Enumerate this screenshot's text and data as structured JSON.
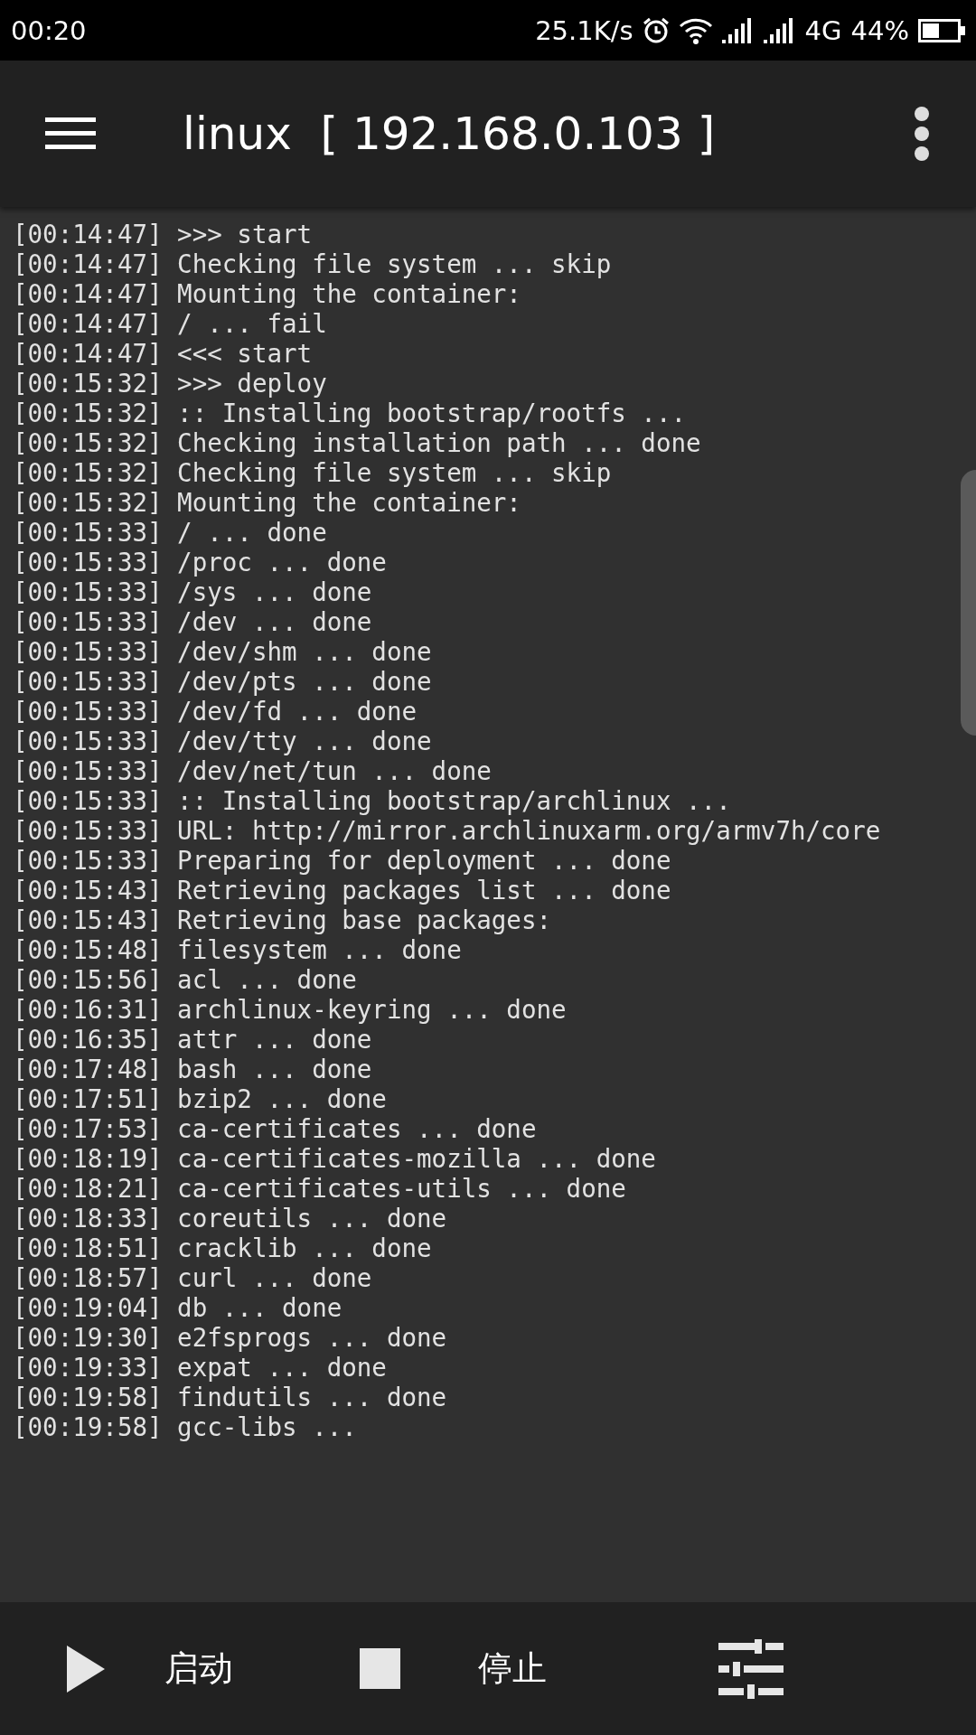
{
  "status_bar": {
    "time": "00:20",
    "speed": "25.1K/s",
    "network": "4G",
    "battery": "44%"
  },
  "toolbar": {
    "title": "linux  [ 192.168.0.103 ]"
  },
  "log": [
    "[00:14:47] >>> start",
    "[00:14:47] Checking file system ... skip",
    "[00:14:47] Mounting the container:",
    "[00:14:47] / ... fail",
    "[00:14:47] <<< start",
    "[00:15:32] >>> deploy",
    "[00:15:32] :: Installing bootstrap/rootfs ...",
    "[00:15:32] Checking installation path ... done",
    "[00:15:32] Checking file system ... skip",
    "[00:15:32] Mounting the container:",
    "[00:15:33] / ... done",
    "[00:15:33] /proc ... done",
    "[00:15:33] /sys ... done",
    "[00:15:33] /dev ... done",
    "[00:15:33] /dev/shm ... done",
    "[00:15:33] /dev/pts ... done",
    "[00:15:33] /dev/fd ... done",
    "[00:15:33] /dev/tty ... done",
    "[00:15:33] /dev/net/tun ... done",
    "[00:15:33] :: Installing bootstrap/archlinux ...",
    "[00:15:33] URL: http://mirror.archlinuxarm.org/armv7h/core",
    "[00:15:33] Preparing for deployment ... done",
    "[00:15:43] Retrieving packages list ... done",
    "[00:15:43] Retrieving base packages:",
    "[00:15:48] filesystem ... done",
    "[00:15:56] acl ... done",
    "[00:16:31] archlinux-keyring ... done",
    "[00:16:35] attr ... done",
    "[00:17:48] bash ... done",
    "[00:17:51] bzip2 ... done",
    "[00:17:53] ca-certificates ... done",
    "[00:18:19] ca-certificates-mozilla ... done",
    "[00:18:21] ca-certificates-utils ... done",
    "[00:18:33] coreutils ... done",
    "[00:18:51] cracklib ... done",
    "[00:18:57] curl ... done",
    "[00:19:04] db ... done",
    "[00:19:30] e2fsprogs ... done",
    "[00:19:33] expat ... done",
    "[00:19:58] findutils ... done",
    "[00:19:58] gcc-libs ..."
  ],
  "bottom_bar": [
    {
      "kind": "play",
      "label": "启动"
    },
    {
      "kind": "stop",
      "label": "停止"
    },
    {
      "kind": "settings"
    }
  ]
}
